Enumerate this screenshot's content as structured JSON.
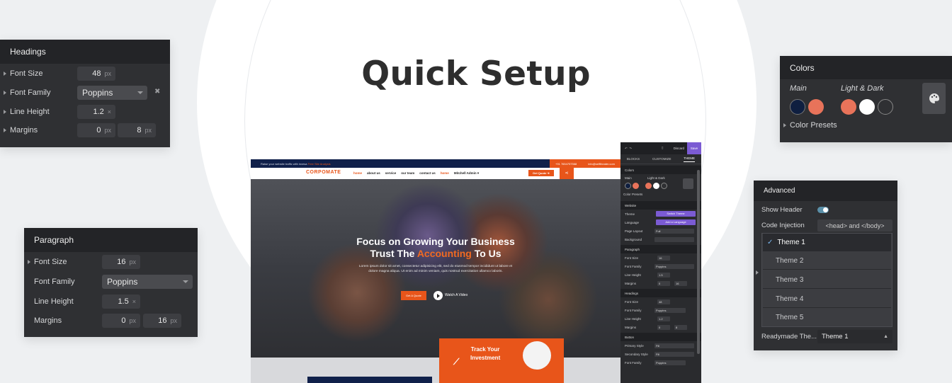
{
  "title": "Quick Setup",
  "headings_panel": {
    "title": "Headings",
    "rows": [
      {
        "label": "Font Size",
        "value": "48",
        "unit": "px"
      },
      {
        "label": "Font Family",
        "value": "Poppins"
      },
      {
        "label": "Line Height",
        "value": "1.2",
        "unit": "×"
      },
      {
        "label": "Margins",
        "value1": "0",
        "unit1": "px",
        "value2": "8",
        "unit2": "px"
      }
    ],
    "clear_icon": "✖"
  },
  "paragraph_panel": {
    "title": "Paragraph",
    "rows": [
      {
        "label": "Font Size",
        "value": "16",
        "unit": "px"
      },
      {
        "label": "Font Family",
        "value": "Poppins"
      },
      {
        "label": "Line Height",
        "value": "1.5",
        "unit": "×"
      },
      {
        "label": "Margins",
        "value1": "0",
        "unit1": "px",
        "value2": "16",
        "unit2": "px"
      }
    ]
  },
  "colors_panel": {
    "title": "Colors",
    "main_label": "Main",
    "light_dark_label": "Light & Dark",
    "presets_label": "Color Presets",
    "main_colors": [
      "#0f1f40",
      "#e8735a"
    ],
    "light_dark_colors": [
      "#e8735a",
      "#ffffff",
      "#2f3033"
    ],
    "palette_icon": "palette-icon"
  },
  "advanced_panel": {
    "title": "Advanced",
    "show_header_label": "Show Header",
    "code_injection_label": "Code Injection",
    "code_injection_value": "<head> and </body>",
    "themes": [
      "Theme 1",
      "Theme 2",
      "Theme 3",
      "Theme 4",
      "Theme 5"
    ],
    "readymade_label": "Readymade The...",
    "readymade_value": "Theme 1"
  },
  "website": {
    "topbar_text": "Raise your website traffic with invesa",
    "topbar_link": "Free Site Analysis",
    "phone": "+91 7654757568",
    "email": "info@selftheater.com",
    "logo": "CORPOMATE",
    "nav": [
      "home",
      "about us",
      "service",
      "our team",
      "contact us",
      "home",
      "Mitchell Admin ▾"
    ],
    "quote_button": "Get Quote ➔",
    "hero_line1": "Focus on Growing Your Business",
    "hero_line2a": "Trust The",
    "hero_accent": "Accounting",
    "hero_line2b": "To Us",
    "hero_paragraph": "Lorem ipsum dolor sit amet, consectetur adipisicing elit, sed do eiusmod tempor incididunt ut labore et dolore magna aliqua. Ut enim ad minim veniam, quis nostrud exercitation ullamco laboris.",
    "more_button": "Get A Quote",
    "watch_label": "Watch A Video",
    "track_line1": "Track Your",
    "track_line2": "Investment",
    "colors": {
      "navy": "#10204a",
      "orange": "#e8551a"
    }
  },
  "editor_sidebar": {
    "discard": "Discard",
    "save": "Save",
    "tabs": [
      "BLOCKS",
      "CUSTOMIZE",
      "THEME"
    ],
    "colors_title": "Colors",
    "main": "Main",
    "light_dark": "Light & Dark",
    "color_presets": "Color Presets",
    "website_title": "Website",
    "theme_label": "Theme",
    "theme_button": "Switch Theme",
    "language_label": "Language",
    "language_button": "Add a Language",
    "page_layout_label": "Page Layout",
    "page_layout_value": "Full",
    "background_label": "Background",
    "paragraph_title": "Paragraph",
    "headings_title": "Headings",
    "button_title": "Button",
    "rows_paragraph": [
      {
        "label": "Font Size",
        "value": "16"
      },
      {
        "label": "Font Family",
        "value": "Poppins"
      },
      {
        "label": "Line Height",
        "value": "1.5"
      },
      {
        "label": "Margins",
        "value1": "0",
        "value2": "16"
      }
    ],
    "rows_headings": [
      {
        "label": "Font Size",
        "value": "48"
      },
      {
        "label": "Font Family",
        "value": "Poppins"
      },
      {
        "label": "Line Height",
        "value": "1.2"
      },
      {
        "label": "Margins",
        "value1": "0",
        "value2": "8"
      }
    ],
    "rows_button": [
      {
        "label": "Primary Style",
        "value": "Fill"
      },
      {
        "label": "Secondary Style",
        "value": "Fill"
      },
      {
        "label": "Font Family",
        "value": "Poppins"
      }
    ]
  }
}
